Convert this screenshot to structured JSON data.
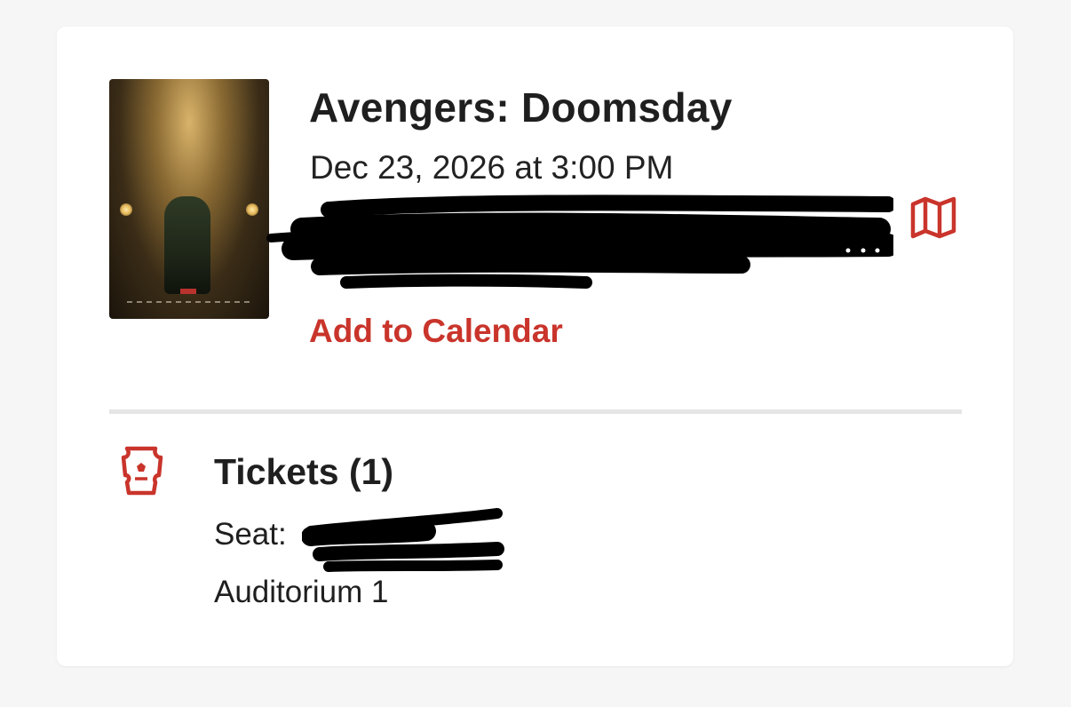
{
  "event": {
    "title": "Avengers: Doomsday",
    "datetime": "Dec 23, 2026 at 3:00 PM",
    "add_to_calendar_label": "Add to Calendar",
    "map_icon": "map-icon"
  },
  "tickets": {
    "title": "Tickets (1)",
    "seat_label": "Seat:",
    "auditorium": "Auditorium 1",
    "icon": "ticket-icon"
  },
  "colors": {
    "accent": "#c9342b",
    "text": "#1f1f1f",
    "background": "#f6f6f6",
    "card": "#ffffff",
    "divider": "#e5e5e5"
  }
}
